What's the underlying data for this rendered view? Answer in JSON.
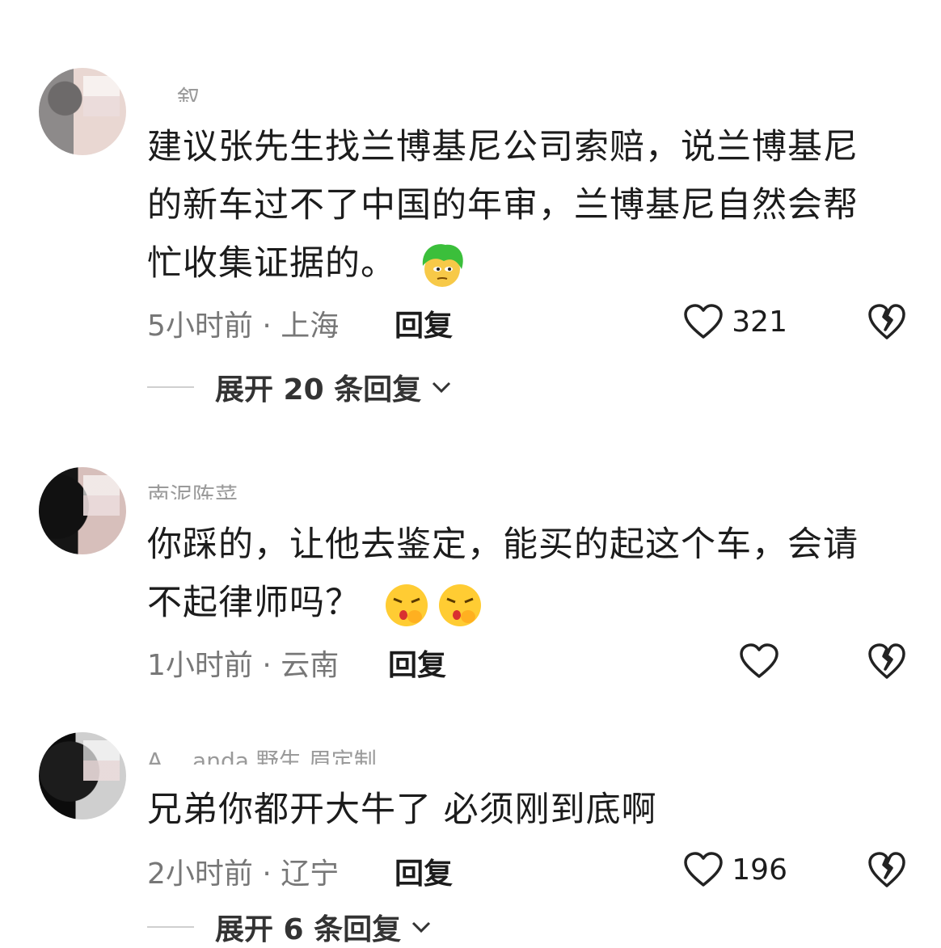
{
  "comments": [
    {
      "username": "… 叙",
      "text": "建议张先生找兰博基尼公司索赔，说兰博基尼的新车过不了中国的年审，兰博基尼自然会帮忙收集证据的。",
      "emojis": [
        "green-hair-face-icon"
      ],
      "time": "5小时前 · 上海",
      "reply_label": "回复",
      "likes": "321",
      "expand": "展开 20 条回复"
    },
    {
      "username": "南泥陈菜",
      "text": "你踩的，让他去鉴定，能买的起这个车，会请不起律师吗？",
      "emojis": [
        "shh-face-icon",
        "shh-face-icon"
      ],
      "time": "1小时前 · 云南",
      "reply_label": "回复",
      "likes": ""
    },
    {
      "username": "A… anda 野生 眉定制",
      "text": "兄弟你都开大牛了 必须刚到底啊",
      "time": "2小时前 · 辽宁",
      "reply_label": "回复",
      "likes": "196",
      "expand": "展开 6 条回复"
    }
  ],
  "colors": {
    "text": "#1c1c1c",
    "meta": "#777777",
    "background": "#ffffff"
  }
}
